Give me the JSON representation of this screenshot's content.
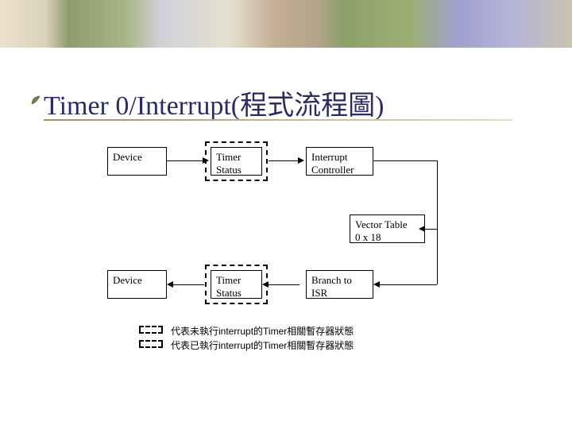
{
  "title": "Timer 0/Interrupt(程式流程圖)",
  "nodes": {
    "device_top": "Device",
    "timer_status_top_l1": "Timer",
    "timer_status_top_l2": "Status",
    "interrupt_controller_l1": "Interrupt",
    "interrupt_controller_l2": "Controller",
    "vector_table_l1": "Vector Table",
    "vector_table_l2": "0 x 18",
    "device_bottom": "Device",
    "timer_status_bottom_l1": "Timer",
    "timer_status_bottom_l2": "Status",
    "branch_isr_l1": "Branch to",
    "branch_isr_l2": "ISR"
  },
  "legend": {
    "line1": "代表未執行interrupt的Timer相關暫存器狀態",
    "line2": "代表已執行interrupt的Timer相關暫存器狀態"
  }
}
